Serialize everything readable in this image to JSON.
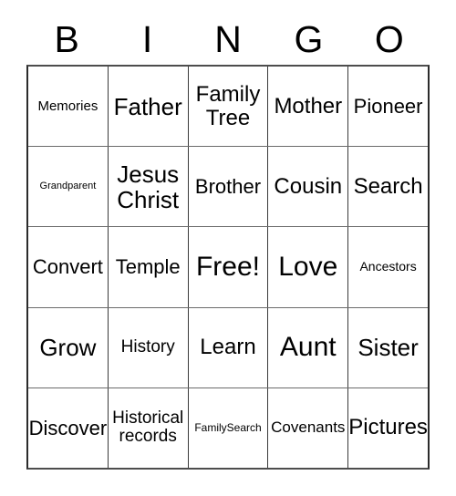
{
  "card": {
    "title": "BINGO",
    "header_letters": [
      "B",
      "I",
      "N",
      "G",
      "O"
    ],
    "grid_size": "5x5",
    "free_space": "Free!",
    "colors": {
      "background": "#ffffff",
      "text": "#000000",
      "grid_line": "#3a3a3a",
      "outer_border": "#2b2b2b"
    }
  },
  "grid": {
    "rows": [
      {
        "cells": [
          {
            "label": "Memories",
            "size": "m"
          },
          {
            "label": "Father",
            "size": "4xl"
          },
          {
            "label": "Family Tree",
            "size": "3xl"
          },
          {
            "label": "Mother",
            "size": "3xl"
          },
          {
            "label": "Pioneer",
            "size": "2xl"
          }
        ]
      },
      {
        "cells": [
          {
            "label": "Grandparent",
            "size": "xxs"
          },
          {
            "label": "Jesus Christ",
            "size": "4xl"
          },
          {
            "label": "Brother",
            "size": "2xl"
          },
          {
            "label": "Cousin",
            "size": "3xl"
          },
          {
            "label": "Search",
            "size": "3xl"
          }
        ]
      },
      {
        "cells": [
          {
            "label": "Convert",
            "size": "2xl"
          },
          {
            "label": "Temple",
            "size": "2xl"
          },
          {
            "label": "Free!",
            "size": "5xl"
          },
          {
            "label": "Love",
            "size": "5xl"
          },
          {
            "label": "Ancestors",
            "size": "s"
          }
        ]
      },
      {
        "cells": [
          {
            "label": "Grow",
            "size": "4xl"
          },
          {
            "label": "History",
            "size": "xl"
          },
          {
            "label": "Learn",
            "size": "3xl"
          },
          {
            "label": "Aunt",
            "size": "5xl"
          },
          {
            "label": "Sister",
            "size": "4xl"
          }
        ]
      },
      {
        "cells": [
          {
            "label": "Discover",
            "size": "2xl"
          },
          {
            "label": "Historical records",
            "size": "xl"
          },
          {
            "label": "FamilySearch",
            "size": "xs"
          },
          {
            "label": "Covenants",
            "size": "l"
          },
          {
            "label": "Pictures",
            "size": "3xl"
          }
        ]
      }
    ]
  }
}
